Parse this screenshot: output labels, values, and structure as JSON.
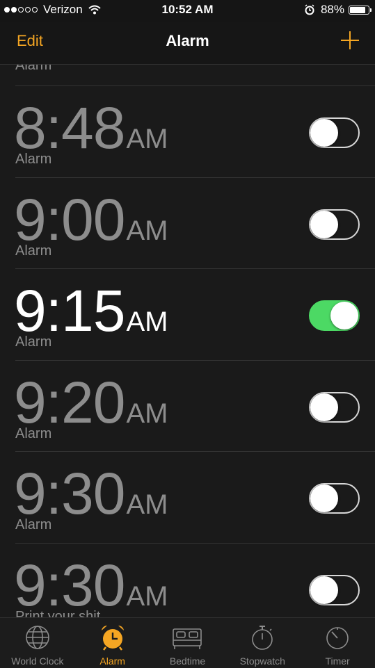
{
  "status_bar": {
    "carrier": "Verizon",
    "time": "10:52 AM",
    "battery": "88%",
    "battery_level": 0.88,
    "signal_bars": 2
  },
  "nav": {
    "edit_label": "Edit",
    "title": "Alarm",
    "add_icon": "plus-icon"
  },
  "list": {
    "partial_top_label": "Alarm",
    "alarms": [
      {
        "time": "8:48",
        "ampm": "AM",
        "label": "Alarm",
        "enabled": false
      },
      {
        "time": "9:00",
        "ampm": "AM",
        "label": "Alarm",
        "enabled": false
      },
      {
        "time": "9:15",
        "ampm": "AM",
        "label": "Alarm",
        "enabled": true
      },
      {
        "time": "9:20",
        "ampm": "AM",
        "label": "Alarm",
        "enabled": false
      },
      {
        "time": "9:30",
        "ampm": "AM",
        "label": "Alarm",
        "enabled": false
      },
      {
        "time": "9:30",
        "ampm": "AM",
        "label": "Print your shit",
        "enabled": false
      }
    ]
  },
  "tabs": [
    {
      "label": "World Clock",
      "icon": "globe-icon",
      "active": false
    },
    {
      "label": "Alarm",
      "icon": "alarm-clock-icon",
      "active": true
    },
    {
      "label": "Bedtime",
      "icon": "bed-icon",
      "active": false
    },
    {
      "label": "Stopwatch",
      "icon": "stopwatch-icon",
      "active": false
    },
    {
      "label": "Timer",
      "icon": "timer-icon",
      "active": false
    }
  ],
  "colors": {
    "accent": "#f5a623",
    "toggle_on": "#4cd964",
    "background": "#1a1a1a",
    "inactive_text": "#8d8d8d"
  }
}
